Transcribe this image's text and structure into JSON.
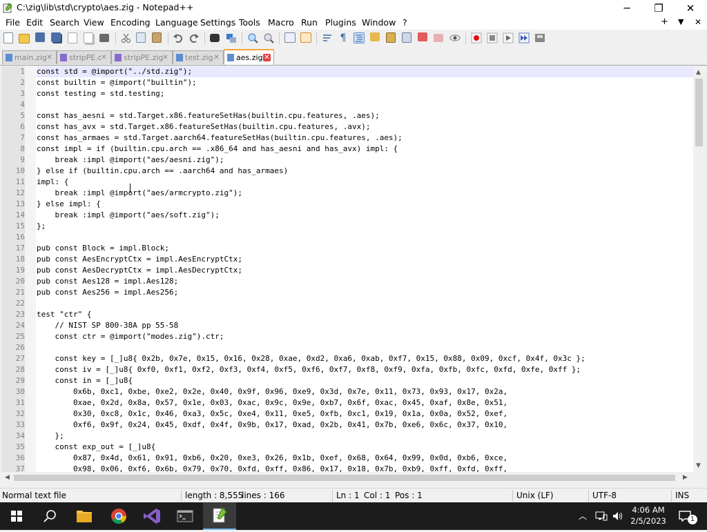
{
  "window": {
    "title": "C:\\zig\\lib\\std\\crypto\\aes.zig - Notepad++",
    "controls": {
      "minimize": "─",
      "maximize": "❐",
      "close": "✕"
    }
  },
  "menu": {
    "items": [
      "File",
      "Edit",
      "Search",
      "View",
      "Encoding",
      "Language",
      "Settings",
      "Tools",
      "Macro",
      "Run",
      "Plugins",
      "Window",
      "?"
    ],
    "right": {
      "plus": "+",
      "dropdown": "▼",
      "close": "✕"
    }
  },
  "tabs": [
    {
      "label": "main.zig",
      "icon_color": "#5b8fd1",
      "active": false
    },
    {
      "label": "stripPE.c",
      "icon_color": "#8a6ad0",
      "active": false
    },
    {
      "label": "stripPE.zig",
      "icon_color": "#8a6ad0",
      "active": false
    },
    {
      "label": "test.zig",
      "icon_color": "#5b8fd1",
      "active": false
    },
    {
      "label": "aes.zig",
      "icon_color": "#e04343",
      "active": true
    }
  ],
  "tab_close_glyph": "✕",
  "editor": {
    "lines": [
      {
        "n": "1",
        "text": "const std = @import(\"../std.zig\");"
      },
      {
        "n": "2",
        "text": "const builtin = @import(\"builtin\");"
      },
      {
        "n": "3",
        "text": "const testing = std.testing;"
      },
      {
        "n": "4",
        "text": ""
      },
      {
        "n": "5",
        "text": "const has_aesni = std.Target.x86.featureSetHas(builtin.cpu.features, .aes);"
      },
      {
        "n": "6",
        "text": "const has_avx = std.Target.x86.featureSetHas(builtin.cpu.features, .avx);"
      },
      {
        "n": "7",
        "text": "const has_armaes = std.Target.aarch64.featureSetHas(builtin.cpu.features, .aes);"
      },
      {
        "n": "8",
        "text": "const impl = if (builtin.cpu.arch == .x86_64 and has_aesni and has_avx) impl: {"
      },
      {
        "n": "9",
        "text": "    break :impl @import(\"aes/aesni.zig\");"
      },
      {
        "n": "10",
        "text": "} else if (builtin.cpu.arch == .aarch64 and has_armaes)"
      },
      {
        "n": "11",
        "text": "impl: {"
      },
      {
        "n": "12",
        "text": "    break :impl @import(\"aes/armcrypto.zig\");"
      },
      {
        "n": "13",
        "text": "} else impl: {"
      },
      {
        "n": "14",
        "text": "    break :impl @import(\"aes/soft.zig\");"
      },
      {
        "n": "15",
        "text": "};"
      },
      {
        "n": "16",
        "text": ""
      },
      {
        "n": "17",
        "text": "pub const Block = impl.Block;"
      },
      {
        "n": "18",
        "text": "pub const AesEncryptCtx = impl.AesEncryptCtx;"
      },
      {
        "n": "19",
        "text": "pub const AesDecryptCtx = impl.AesDecryptCtx;"
      },
      {
        "n": "20",
        "text": "pub const Aes128 = impl.Aes128;"
      },
      {
        "n": "21",
        "text": "pub const Aes256 = impl.Aes256;"
      },
      {
        "n": "22",
        "text": ""
      },
      {
        "n": "23",
        "text": "test \"ctr\" {"
      },
      {
        "n": "24",
        "text": "    // NIST SP 800-38A pp 55-58"
      },
      {
        "n": "25",
        "text": "    const ctr = @import(\"modes.zig\").ctr;"
      },
      {
        "n": "26",
        "text": ""
      },
      {
        "n": "27",
        "text": "    const key = [_]u8{ 0x2b, 0x7e, 0x15, 0x16, 0x28, 0xae, 0xd2, 0xa6, 0xab, 0xf7, 0x15, 0x88, 0x09, 0xcf, 0x4f, 0x3c };"
      },
      {
        "n": "28",
        "text": "    const iv = [_]u8{ 0xf0, 0xf1, 0xf2, 0xf3, 0xf4, 0xf5, 0xf6, 0xf7, 0xf8, 0xf9, 0xfa, 0xfb, 0xfc, 0xfd, 0xfe, 0xff };"
      },
      {
        "n": "29",
        "text": "    const in = [_]u8{"
      },
      {
        "n": "30",
        "text": "        0x6b, 0xc1, 0xbe, 0xe2, 0x2e, 0x40, 0x9f, 0x96, 0xe9, 0x3d, 0x7e, 0x11, 0x73, 0x93, 0x17, 0x2a,"
      },
      {
        "n": "31",
        "text": "        0xae, 0x2d, 0x8a, 0x57, 0x1e, 0x03, 0xac, 0x9c, 0x9e, 0xb7, 0x6f, 0xac, 0x45, 0xaf, 0x8e, 0x51,"
      },
      {
        "n": "32",
        "text": "        0x30, 0xc8, 0x1c, 0x46, 0xa3, 0x5c, 0xe4, 0x11, 0xe5, 0xfb, 0xc1, 0x19, 0x1a, 0x0a, 0x52, 0xef,"
      },
      {
        "n": "33",
        "text": "        0xf6, 0x9f, 0x24, 0x45, 0xdf, 0x4f, 0x9b, 0x17, 0xad, 0x2b, 0x41, 0x7b, 0xe6, 0x6c, 0x37, 0x10,"
      },
      {
        "n": "34",
        "text": "    };"
      },
      {
        "n": "35",
        "text": "    const exp_out = [_]u8{"
      },
      {
        "n": "36",
        "text": "        0x87, 0x4d, 0x61, 0x91, 0xb6, 0x20, 0xe3, 0x26, 0x1b, 0xef, 0x68, 0x64, 0x99, 0x0d, 0xb6, 0xce,"
      },
      {
        "n": "37",
        "text": "        0x98, 0x06, 0xf6, 0x6b, 0x79, 0x70, 0xfd, 0xff, 0x86, 0x17, 0x18, 0x7b, 0xb9, 0xff, 0xfd, 0xff,"
      }
    ]
  },
  "status": {
    "file_type": "Normal text file",
    "length": "length : 8,555",
    "lines": "lines : 166",
    "ln": "Ln : 1",
    "col": "Col : 1",
    "pos": "Pos : 1",
    "eol": "Unix (LF)",
    "encoding": "UTF-8",
    "mode": "INS"
  },
  "taskbar": {
    "time": "4:06 AM",
    "date": "2/5/2023"
  },
  "colors": {
    "active_tab_accent": "#f7a633",
    "taskbar_bg": "#1c1c1c"
  }
}
